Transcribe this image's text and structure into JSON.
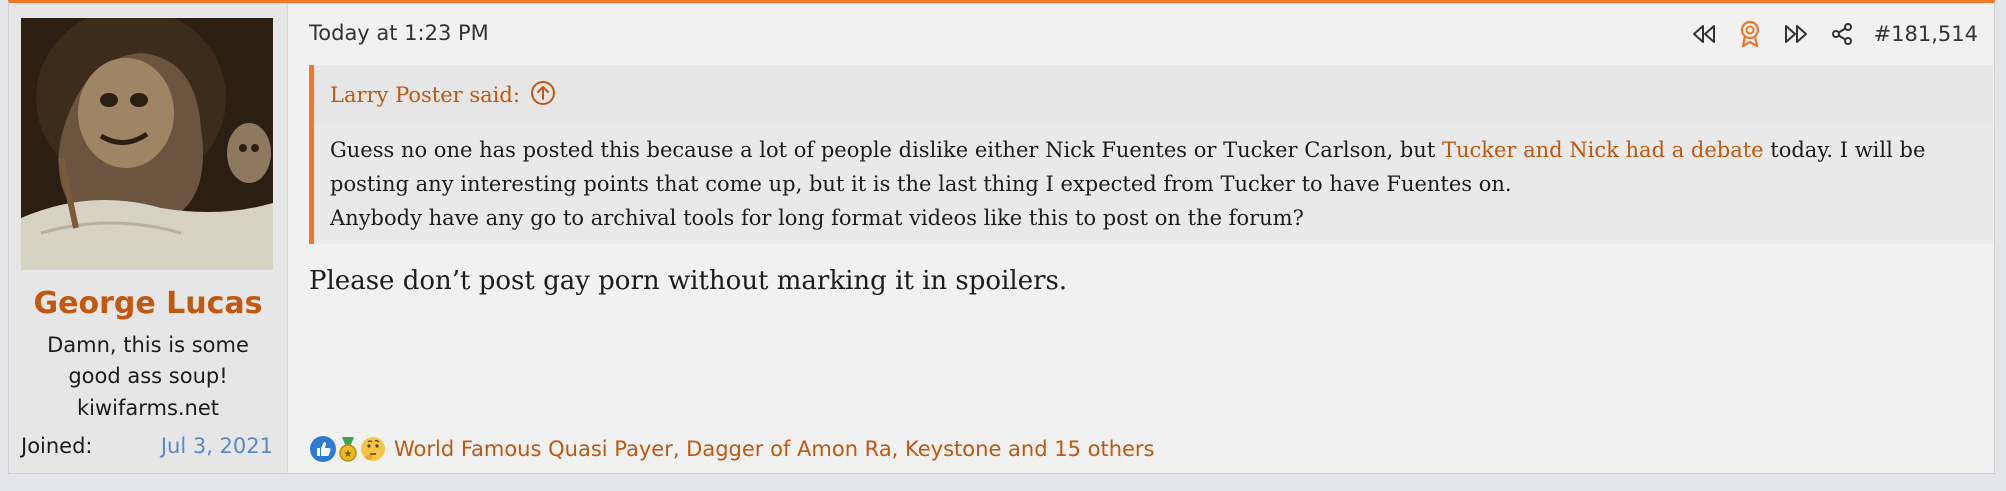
{
  "user": {
    "name": "George Lucas",
    "title": "Damn, this is some good ass soup!",
    "site": "kiwifarms.net",
    "joined_label": "Joined:",
    "joined_value": "Jul 3, 2021"
  },
  "post": {
    "timestamp": "Today at 1:23 PM",
    "number": "#181,514",
    "action_icons": [
      "rewind-icon",
      "award-icon",
      "fast-forward-icon",
      "share-icon"
    ],
    "quote": {
      "author_label": "Larry Poster said:",
      "text_before": "Guess no one has posted this because a lot of people dislike either Nick Fuentes or Tucker Carlson, but ",
      "link_text": "Tucker and Nick had a debate",
      "text_after": " today. I will be posting any interesting points that come up, but it is the last thing I expected from Tucker to have Fuentes on.",
      "text_line3": "Anybody have any go to archival tools for long format videos like this to post on the forum?"
    },
    "body": "Please don’t post gay porn without marking it in spoilers.",
    "reactions": {
      "icons": [
        "thumbs-up-icon",
        "medal-icon",
        "thinking-face-icon"
      ],
      "text": "World Famous Quasi Payer, Dagger of Amon Ra, Keystone and 15 others"
    }
  },
  "colors": {
    "accent": "#f0772a",
    "link": "#c2570f",
    "joined_date": "#5b8ac0"
  }
}
